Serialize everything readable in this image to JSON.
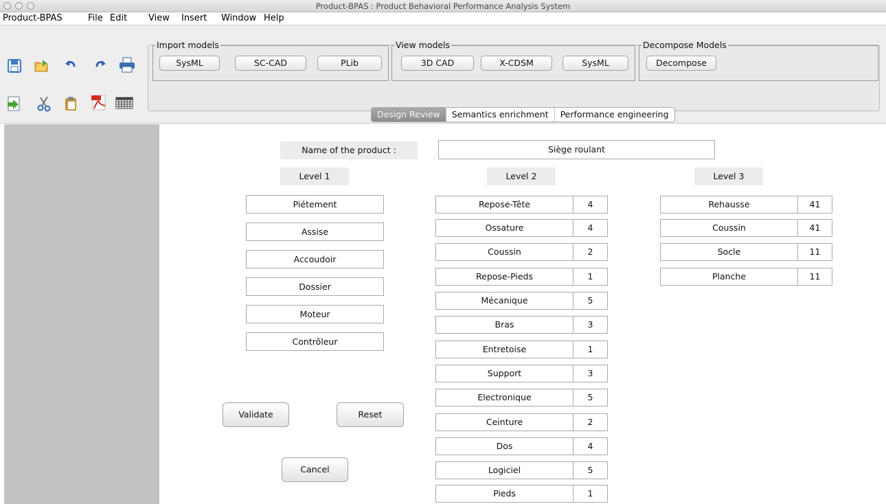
{
  "window": {
    "title": "Product-BPAS : Product Behavioral Performance Analysis System"
  },
  "menubar": {
    "items": [
      "Product-BPAS",
      "File",
      "Edit",
      "View",
      "Insert",
      "Window",
      "Help"
    ]
  },
  "toolbar": {
    "icons": [
      "save-icon",
      "open-folder-icon",
      "undo-icon",
      "redo-icon",
      "print-icon",
      "import-icon",
      "cut-icon",
      "paste-icon",
      "pdf-icon",
      "table-icon"
    ]
  },
  "import_models": {
    "title": "Import models",
    "buttons": [
      "SysML",
      "SC-CAD",
      "PLib"
    ]
  },
  "view_models": {
    "title": "View models",
    "buttons": [
      "3D CAD",
      "X-CDSM",
      "SysML"
    ]
  },
  "decompose_models": {
    "title": "Decompose Models",
    "buttons": [
      "Decompose"
    ]
  },
  "tabs": {
    "items": [
      "Design Review",
      "Semantics enrichment",
      "Performance engineering"
    ],
    "active": "Design Review"
  },
  "product": {
    "name_label": "Name of the product :",
    "name_value": "Siège roulant"
  },
  "levels": {
    "level1": {
      "header": "Level 1",
      "items": [
        "Piétement",
        "Assise",
        "Accoudoir",
        "Dossier",
        "Moteur",
        "Contrôleur"
      ]
    },
    "level2": {
      "header": "Level 2",
      "rows": [
        {
          "name": "Repose-Tête",
          "value": "4"
        },
        {
          "name": "Ossature",
          "value": "4"
        },
        {
          "name": "Coussin",
          "value": "2"
        },
        {
          "name": "Repose-Pieds",
          "value": "1"
        },
        {
          "name": "Mécanique",
          "value": "5"
        },
        {
          "name": "Bras",
          "value": "3"
        },
        {
          "name": "Entretoise",
          "value": "1"
        },
        {
          "name": "Support",
          "value": "3"
        },
        {
          "name": "Electronique",
          "value": "5"
        },
        {
          "name": "Ceinture",
          "value": "2"
        },
        {
          "name": "Dos",
          "value": "4"
        },
        {
          "name": "Logiciel",
          "value": "5"
        },
        {
          "name": "Pieds",
          "value": "1"
        }
      ]
    },
    "level3": {
      "header": "Level 3",
      "rows": [
        {
          "name": "Rehausse",
          "value": "41"
        },
        {
          "name": "Coussin",
          "value": "41"
        },
        {
          "name": "Socle",
          "value": "11"
        },
        {
          "name": "Planche",
          "value": "11"
        }
      ]
    }
  },
  "actions": {
    "validate": "Validate",
    "reset": "Reset",
    "cancel": "Cancel"
  }
}
